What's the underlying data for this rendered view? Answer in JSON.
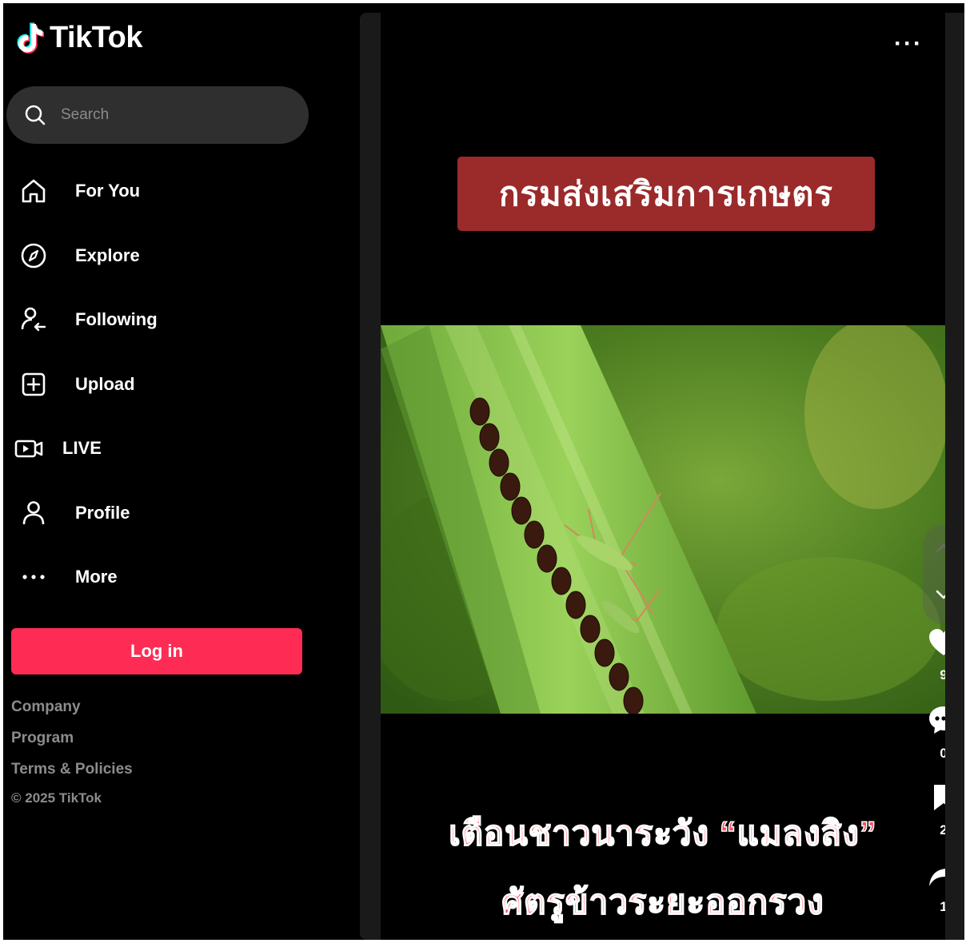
{
  "app": {
    "name": "TikTok"
  },
  "search": {
    "placeholder": "Search"
  },
  "nav": [
    {
      "label": "For You",
      "icon": "home-icon"
    },
    {
      "label": "Explore",
      "icon": "compass-icon"
    },
    {
      "label": "Following",
      "icon": "following-icon"
    },
    {
      "label": "Upload",
      "icon": "upload-icon"
    },
    {
      "label": "LIVE",
      "icon": "live-icon"
    },
    {
      "label": "Profile",
      "icon": "profile-icon"
    },
    {
      "label": "More",
      "icon": "more-icon"
    }
  ],
  "login": {
    "label": "Log in"
  },
  "footer": {
    "links": [
      "Company",
      "Program",
      "Terms & Policies"
    ],
    "copyright": "© 2025 TikTok"
  },
  "video": {
    "banner": "กรมส่งเสริมการเกษตร",
    "caption_line1": "เตือนชาวนาระวัง “แมลงสิง”",
    "caption_line2": "ศัตรูข้าวระยะออกรวง",
    "more": "···"
  },
  "actions": {
    "likes": "9",
    "comments": "0",
    "saves": "2",
    "shares": "1"
  },
  "colors": {
    "accent": "#fe2c55",
    "banner": "#9b2a2a",
    "caption": "#ff4a5c"
  }
}
